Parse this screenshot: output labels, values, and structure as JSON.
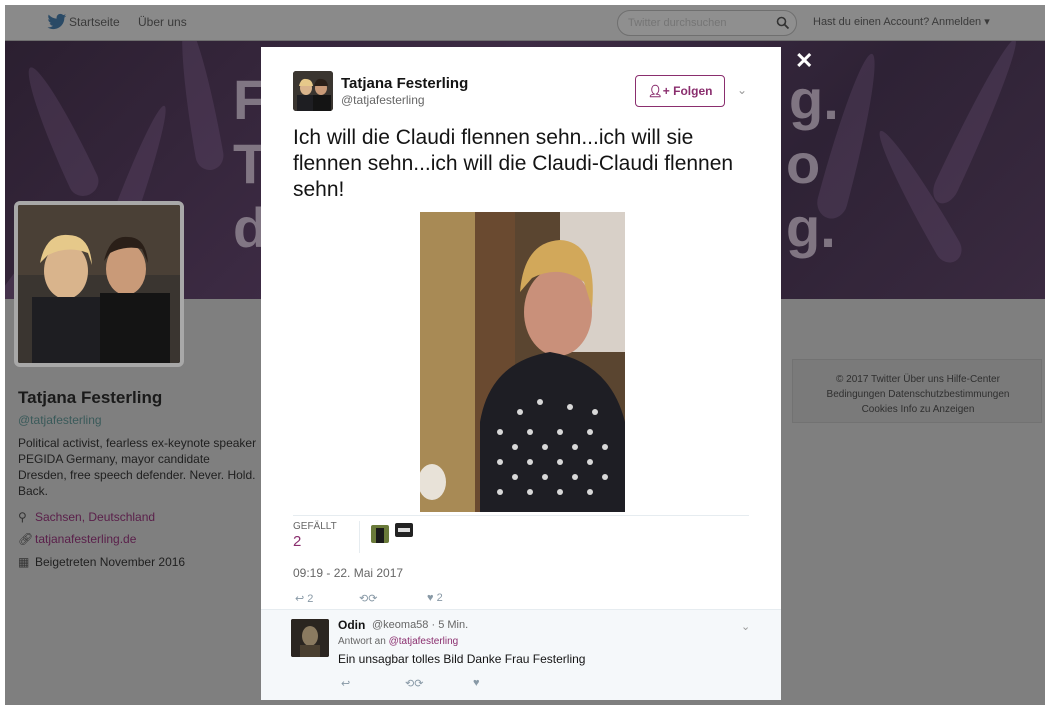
{
  "nav": {
    "home": "Startseite",
    "about": "Über uns",
    "search_placeholder": "Twitter durchsuchen",
    "login": "Hast du einen Account? Anmelden ▾"
  },
  "banner": {
    "line1": "F",
    "line1_end": "g.",
    "line2": "T",
    "line2_end": "o",
    "line3": "d",
    "line3_end": "g."
  },
  "profile": {
    "name": "Tatjana Festerling",
    "handle": "@tatjafesterling",
    "bio": "Political activist, fearless ex-keynote speaker PEGIDA Germany, mayor candidate Dresden, free speech defender. Never. Hold. Back.",
    "location": "Sachsen, Deutschland",
    "website": "tatjanafesterling.de",
    "joined": "Beigetreten November 2016"
  },
  "footer": {
    "line1": "© 2017 Twitter   Über uns   Hilfe-Center",
    "line2": "Bedingungen   Datenschutzbestimmungen",
    "line3": "Cookies   Info zu Anzeigen"
  },
  "tweet": {
    "author_name": "Tatjana Festerling",
    "author_handle": "@tatjafesterling",
    "follow_label": "Folgen",
    "text": "Ich will die Claudi flennen sehn...ich will sie flennen sehn...ich will die Claudi-Claudi flennen sehn!",
    "likes_label": "GEFÄLLT",
    "likes_count": "2",
    "timestamp": "09:19 - 22. Mai 2017",
    "reply_count": "2",
    "like_count": "2"
  },
  "reply": {
    "name": "Odin",
    "meta": "@keoma58 · 5 Min.",
    "reply_to_prefix": "Antwort an ",
    "reply_to_handle": "@tatjafesterling",
    "text": "Ein unsagbar tolles Bild Danke Frau Festerling"
  },
  "colors": {
    "accent": "#8a2e6e",
    "overlay": "#7f7f7f",
    "action_gray": "#8899a6"
  }
}
